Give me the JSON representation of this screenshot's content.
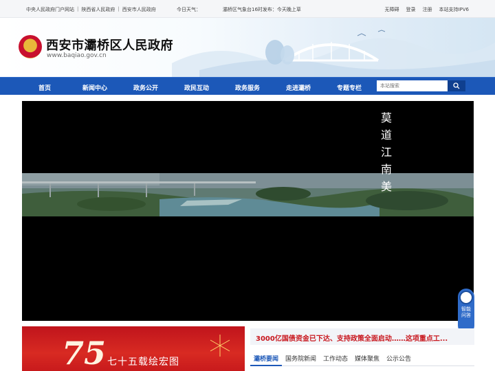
{
  "topbar": {
    "links": [
      "中央人民政府门户网站",
      "陕西省人民政府",
      "西安市人民政府"
    ],
    "separator": "|",
    "weather_label": "今日天气：",
    "forecast": "灞桥区气象台16时发布：今天晚上草",
    "right_links": [
      "无障碍",
      "登录",
      "注册",
      "本站支持IPV6"
    ]
  },
  "header": {
    "title": "西安市灞桥区人民政府",
    "url": "www.baqiao.gov.cn",
    "emblem_icon": "national-emblem-icon"
  },
  "nav": {
    "items": [
      "首页",
      "新闻中心",
      "政务公开",
      "政民互动",
      "政务服务",
      "走进灞桥",
      "专题专栏"
    ],
    "search_placeholder": "本站搜索",
    "search_icon": "search-icon"
  },
  "video": {
    "poem": [
      "莫",
      "道",
      "江",
      "南",
      "美"
    ]
  },
  "assistant": {
    "label_line1": "智能",
    "label_line2": "问答"
  },
  "promo": {
    "number": "75",
    "text": "七十五载绘宏图"
  },
  "news": {
    "headline": "3000亿国债资金已下达、支持政策全面启动……这项重点工...",
    "tabs": [
      "灞桥要闻",
      "国务院新闻",
      "工作动态",
      "媒体聚焦",
      "公示公告"
    ]
  },
  "colors": {
    "nav_blue": "#1c58b8",
    "headline_red": "#c8161d",
    "promo_red": "#c0141c"
  }
}
